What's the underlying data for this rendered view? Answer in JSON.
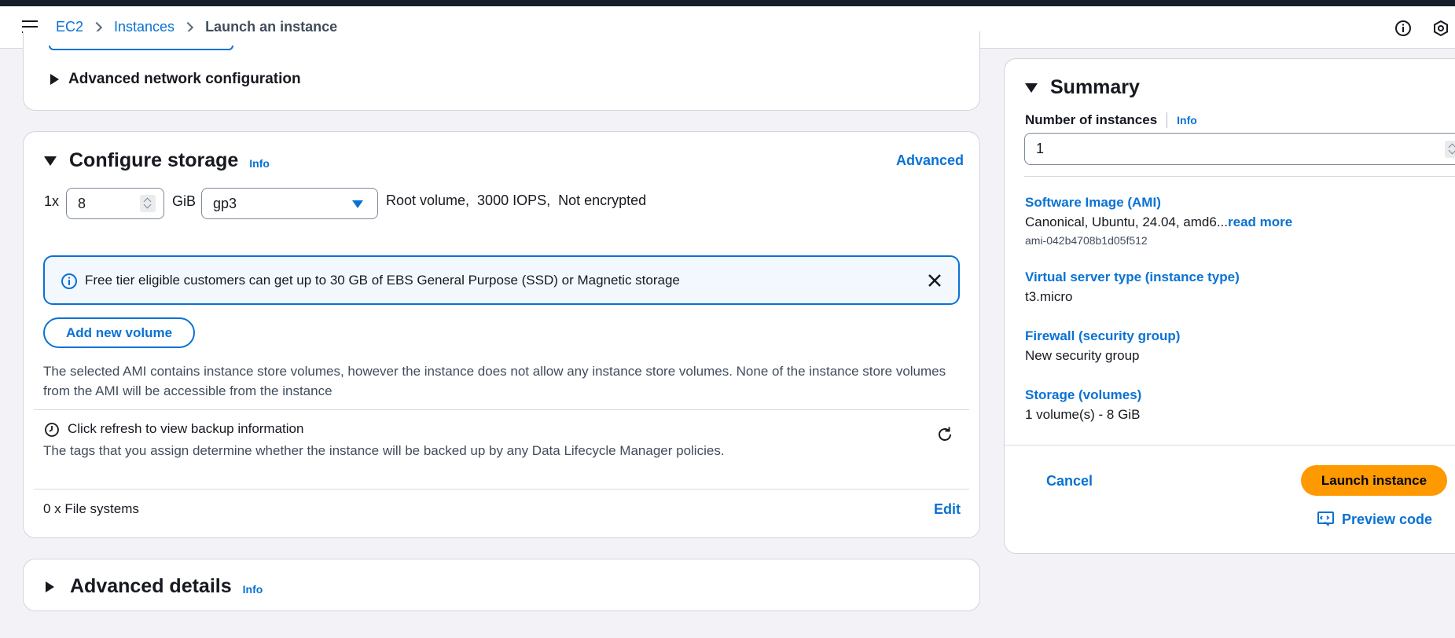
{
  "breadcrumb": {
    "items": [
      "EC2",
      "Instances"
    ],
    "current": "Launch an instance"
  },
  "network": {
    "title": "Advanced network configuration"
  },
  "storage": {
    "title": "Configure storage",
    "info": "Info",
    "advanced": "Advanced",
    "multiplier": "1x",
    "size_value": "8",
    "unit": "GiB",
    "volume_type": "gp3",
    "details": "Root volume,  3000 IOPS,  Not encrypted",
    "alert_text": "Free tier eligible customers can get up to 30 GB of EBS General Purpose (SSD) or Magnetic storage",
    "add_volume": "Add new volume",
    "ami_note": "The selected AMI contains instance store volumes, however the instance does not allow any instance store volumes. None of the instance store volumes from the AMI will be accessible from the instance",
    "backup_title": "Click refresh to view backup information",
    "backup_desc": "The tags that you assign determine whether the instance will be backed up by any Data Lifecycle Manager policies.",
    "file_systems": "0 x File systems",
    "edit": "Edit"
  },
  "advanced_details": {
    "title": "Advanced details",
    "info": "Info"
  },
  "summary": {
    "title": "Summary",
    "instances_label": "Number of instances",
    "info": "Info",
    "instances_value": "1",
    "ami_label": "Software Image (AMI)",
    "ami_value": "Canonical, Ubuntu, 24.04, amd6...",
    "read_more": "read more",
    "ami_id": "ami-042b4708b1d05f512",
    "type_label": "Virtual server type (instance type)",
    "type_value": "t3.micro",
    "firewall_label": "Firewall (security group)",
    "firewall_value": "New security group",
    "storage_label": "Storage (volumes)",
    "storage_value": "1 volume(s) - 8 GiB",
    "cancel": "Cancel",
    "launch": "Launch instance",
    "preview": "Preview code"
  },
  "colors": {
    "accent": "#0972d3",
    "primary_button": "#ff9900",
    "alert_bg": "#f2f8fd"
  }
}
